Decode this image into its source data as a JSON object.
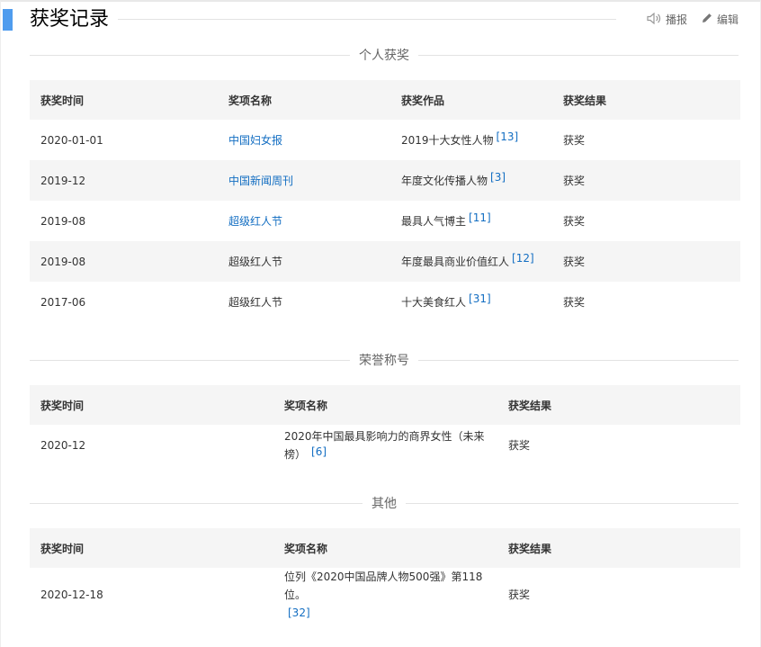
{
  "header": {
    "title": "获奖记录",
    "broadcast_label": "播报",
    "edit_label": "编辑"
  },
  "sections": {
    "personal": {
      "title": "个人获奖",
      "columns": [
        "获奖时间",
        "奖项名称",
        "获奖作品",
        "获奖结果"
      ],
      "rows": [
        {
          "date": "2020-01-01",
          "award": "中国妇女报",
          "work": "2019十大女性人物",
          "ref": "[13]",
          "result": "获奖"
        },
        {
          "date": "2019-12",
          "award": "中国新闻周刊",
          "work": "年度文化传播人物",
          "ref": "[3]",
          "result": "获奖"
        },
        {
          "date": "2019-08",
          "award": "超级红人节",
          "work": "最具人气博主",
          "ref": "[11]",
          "result": "获奖"
        },
        {
          "date": "2019-08",
          "award": "超级红人节",
          "work": "年度最具商业价值红人",
          "ref": "[12]",
          "result": "获奖"
        },
        {
          "date": "2017-06",
          "award": "超级红人节",
          "work": "十大美食红人",
          "ref": "[31]",
          "result": "获奖"
        }
      ]
    },
    "honor": {
      "title": "荣誉称号",
      "columns": [
        "获奖时间",
        "奖项名称",
        "获奖结果"
      ],
      "rows": [
        {
          "date": "2020-12",
          "award_line1": "2020年中国最具影响力的商界女性（未来",
          "award_line2": "榜）",
          "ref": "[6]",
          "result": "获奖"
        }
      ]
    },
    "other": {
      "title": "其他",
      "columns": [
        "获奖时间",
        "奖项名称",
        "获奖结果"
      ],
      "rows": [
        {
          "date": "2020-12-18",
          "award_line1": "位列《2020中国品牌人物500强》第118位。",
          "ref": "[32]",
          "result": "获奖"
        }
      ]
    }
  }
}
